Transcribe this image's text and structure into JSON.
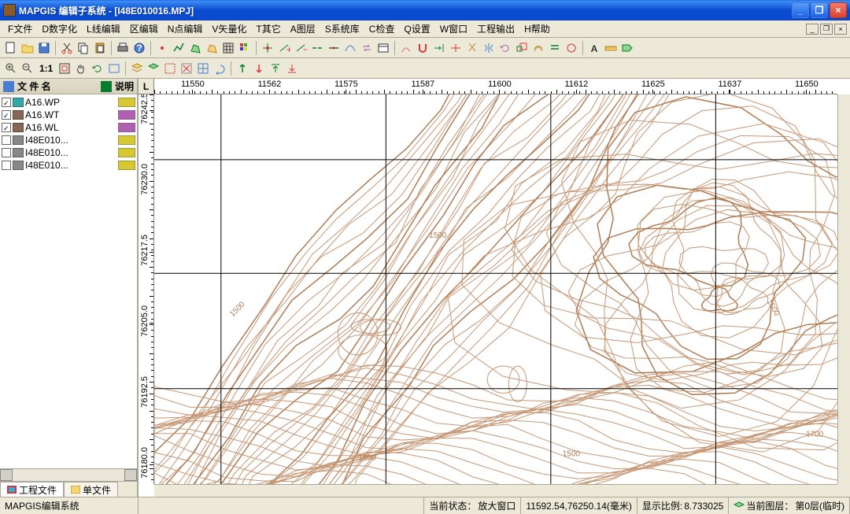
{
  "title": "MAPGIS 编辑子系统 - [I48E010016.MPJ]",
  "menu": [
    "F文件",
    "D数字化",
    "L线编辑",
    "区编辑",
    "N点编辑",
    "V矢量化",
    "T其它",
    "A图层",
    "S系统库",
    "C检查",
    "Q设置",
    "W窗口",
    "工程输出",
    "H帮助"
  ],
  "ruler_h_ticks": [
    "11550",
    "11562",
    "11575",
    "11587",
    "11600",
    "11612",
    "11625",
    "11637",
    "11650"
  ],
  "ruler_v_ticks": [
    "76242.5",
    "76230.0",
    "76217.5",
    "76205.0",
    "76192.5",
    "76180.0"
  ],
  "sidebar": {
    "header_file": "文 件 名",
    "header_desc": "说明",
    "files": [
      {
        "name": "A16.WP",
        "checked": true,
        "color": "#3aa",
        "rc": "#d8c830"
      },
      {
        "name": "A16.WT",
        "checked": true,
        "color": "#865",
        "rc": "#b060b0"
      },
      {
        "name": "A16.WL",
        "checked": true,
        "color": "#865",
        "rc": "#b060b0"
      },
      {
        "name": "I48E010...",
        "checked": false,
        "color": "#888",
        "rc": "#d8c830"
      },
      {
        "name": "I48E010...",
        "checked": false,
        "color": "#888",
        "rc": "#d8c830"
      },
      {
        "name": "I48E010...",
        "checked": false,
        "color": "#888",
        "rc": "#d8c830"
      }
    ],
    "tab_project": "工程文件",
    "tab_single": "单文件"
  },
  "status": {
    "app": "MAPGIS编辑系统",
    "state_label": "当前状态：",
    "state_value": "放大窗口",
    "coord": "11592.54,76250.14(毫米)",
    "scale_label": "显示比例:",
    "scale_value": "8.733025",
    "layer_label": "当前图层：",
    "layer_value": "第0层(临时)"
  },
  "zoom_ratio": "1:1",
  "ruler_corner": "L"
}
